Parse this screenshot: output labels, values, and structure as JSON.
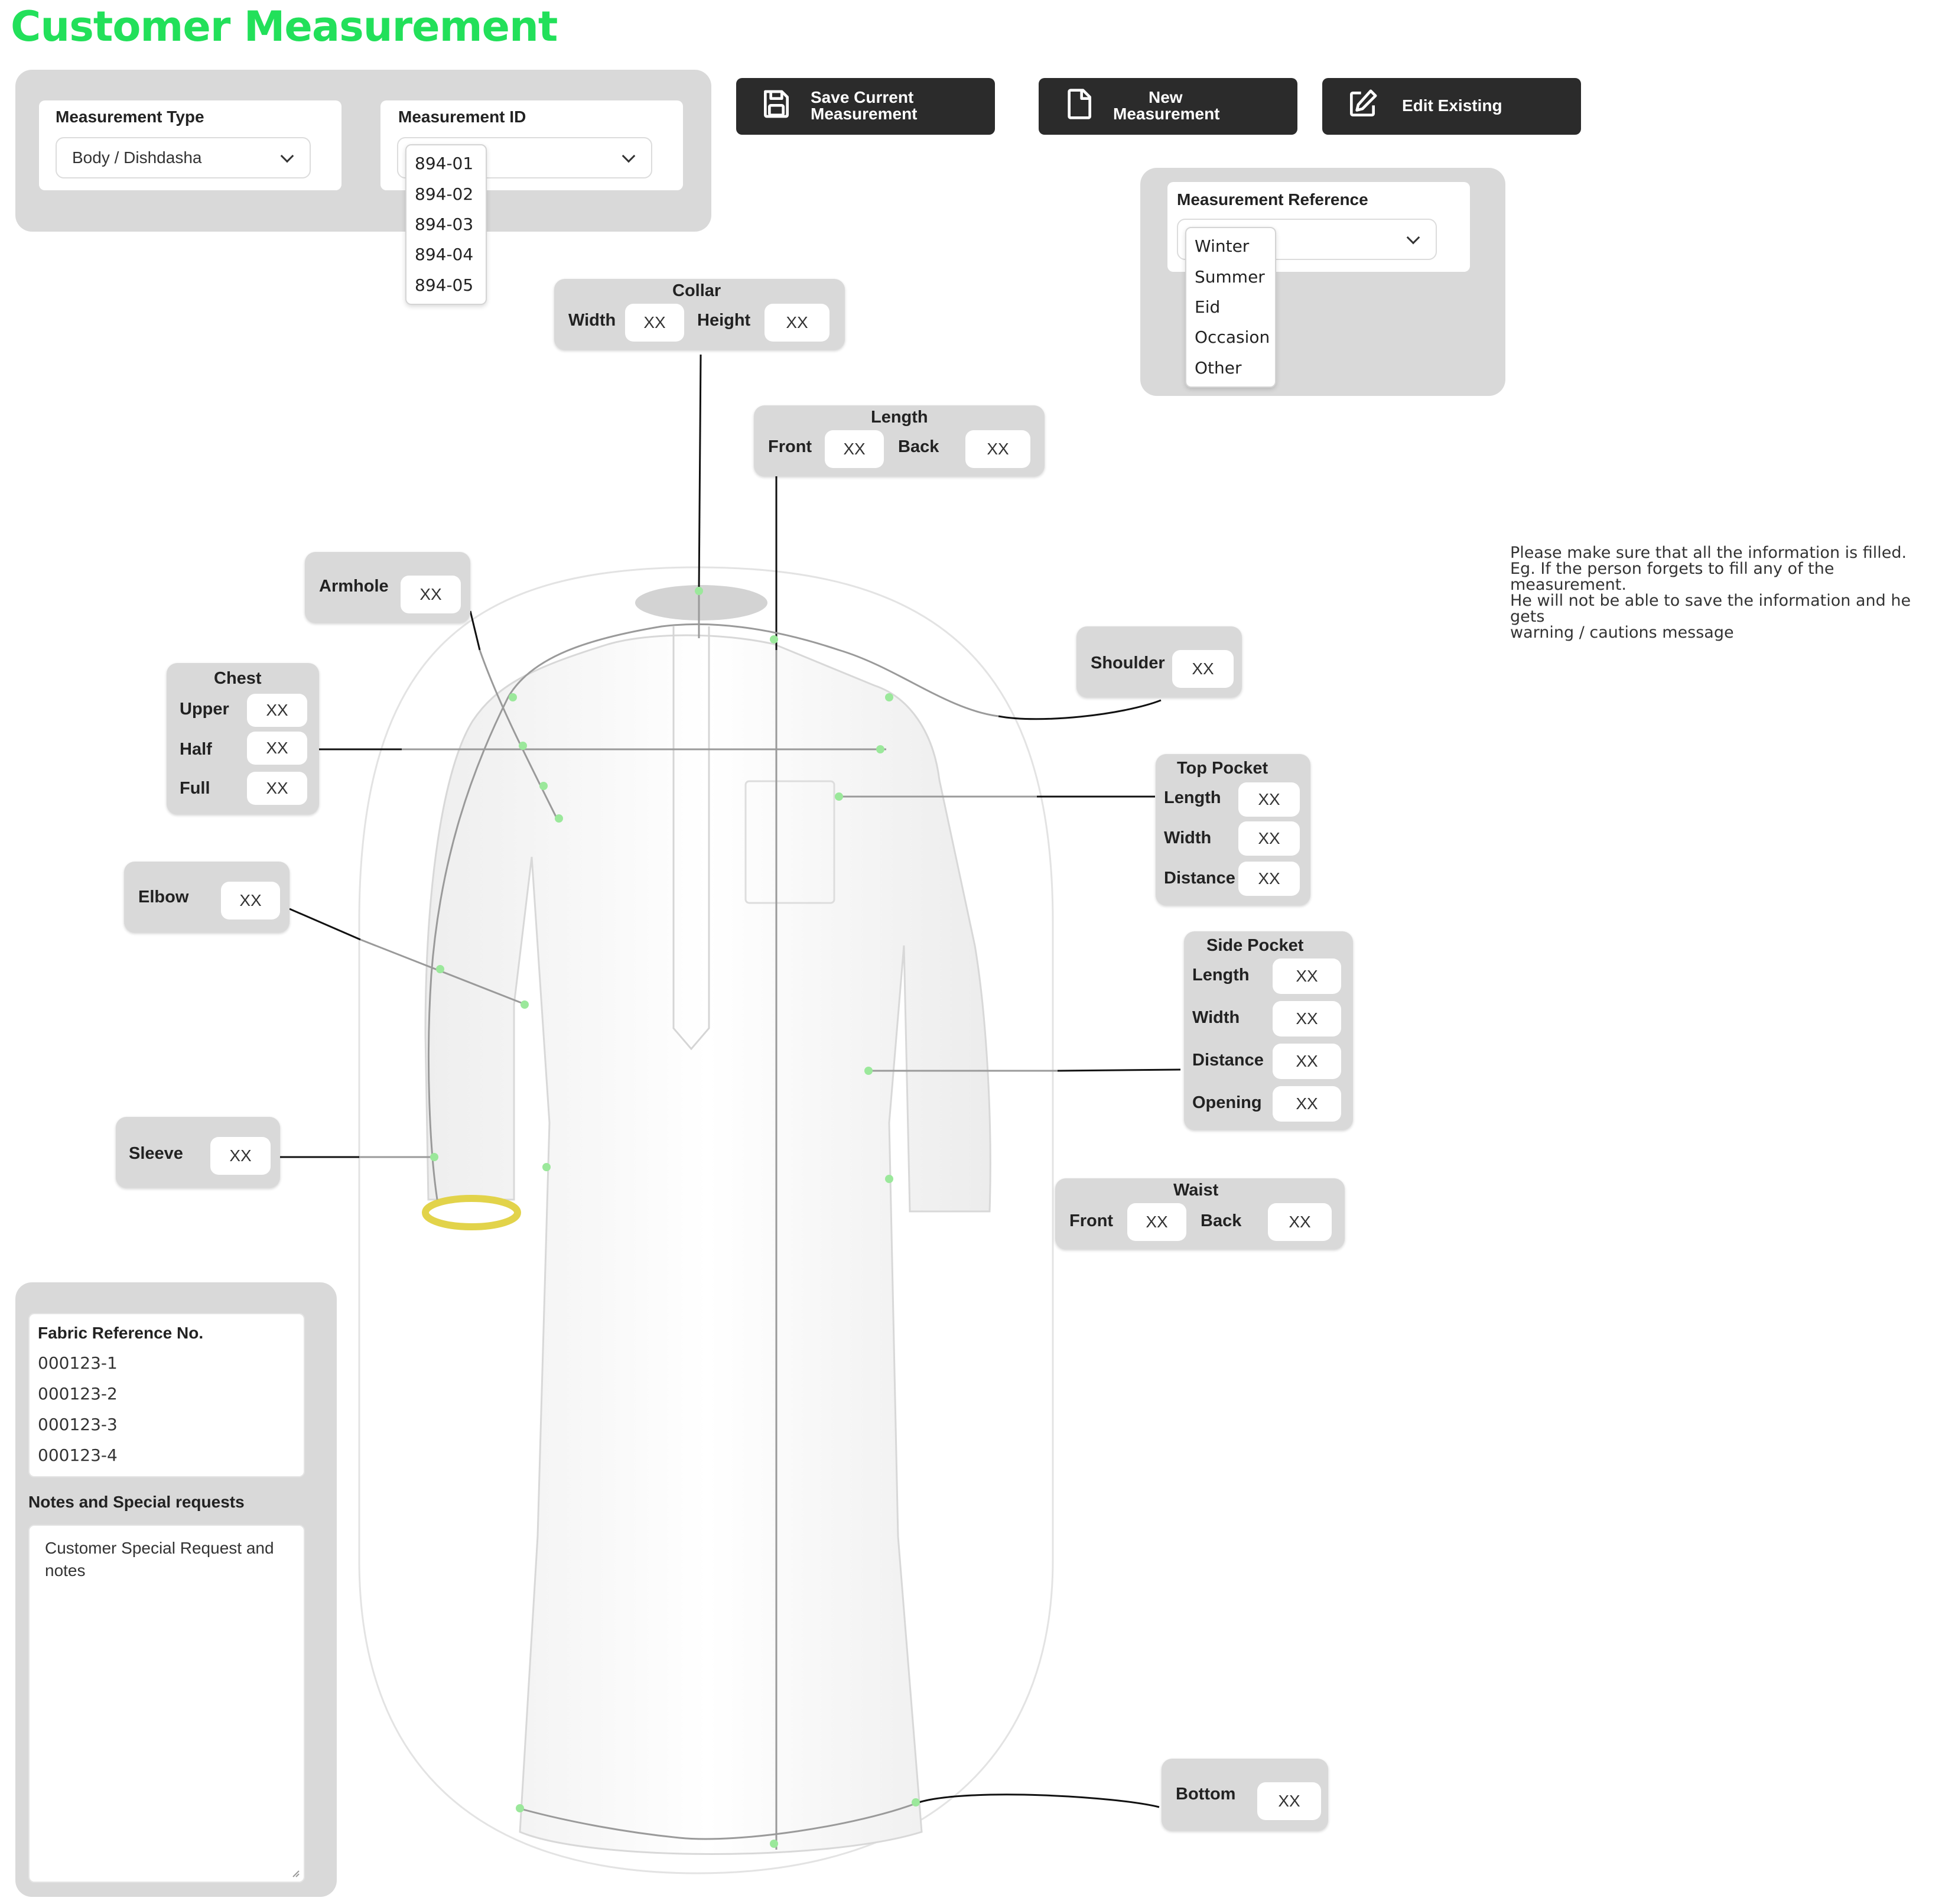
{
  "page": {
    "title": "Customer Measurement"
  },
  "header": {
    "measurement_type": {
      "label": "Measurement Type",
      "value": "Body / Dishdasha"
    },
    "measurement_id": {
      "label": "Measurement ID",
      "options": [
        "894-01",
        "894-02",
        "894-03",
        "894-04",
        "894-05"
      ]
    }
  },
  "toolbar": {
    "save_label_line1": "Save Current",
    "save_label_line2": "Measurement",
    "new_label_line1": "New",
    "new_label_line2": "Measurement",
    "edit_label": "Edit Existing"
  },
  "reference": {
    "label": "Measurement Reference",
    "options": [
      "Winter",
      "Summer",
      "Eid",
      "Occasion",
      "Other"
    ]
  },
  "info_note": {
    "line1": "Please make sure that all the information is filled.",
    "line2": "Eg. If the person forgets to fill any of the measurement.",
    "line3": "He will not be able to save the information and he gets",
    "line4": "warning / cautions message"
  },
  "measurements": {
    "placeholder": "XX",
    "collar": {
      "title": "Collar",
      "width": "Width",
      "height": "Height"
    },
    "length": {
      "title": "Length",
      "front": "Front",
      "back": "Back"
    },
    "armhole": {
      "label": "Armhole"
    },
    "shoulder": {
      "label": "Shoulder"
    },
    "chest": {
      "title": "Chest",
      "upper": "Upper",
      "half": "Half",
      "full": "Full"
    },
    "top_pocket": {
      "title": "Top Pocket",
      "length": "Length",
      "width": "Width",
      "distance": "Distance"
    },
    "elbow": {
      "label": "Elbow"
    },
    "side_pocket": {
      "title": "Side Pocket",
      "length": "Length",
      "width": "Width",
      "distance": "Distance",
      "opening": "Opening"
    },
    "sleeve": {
      "label": "Sleeve"
    },
    "waist": {
      "title": "Waist",
      "front": "Front",
      "back": "Back"
    },
    "bottom": {
      "label": "Bottom"
    }
  },
  "fabric": {
    "label": "Fabric Reference No.",
    "items": [
      "000123-1",
      "000123-2",
      "000123-3",
      "000123-4"
    ]
  },
  "notes": {
    "label": "Notes and Special requests",
    "line1": "Customer Special Request and",
    "line2": "notes"
  },
  "colors": {
    "accent": "#22e05a",
    "button_bg": "#2b2b2b",
    "panel_bg": "#d9d9d9"
  }
}
